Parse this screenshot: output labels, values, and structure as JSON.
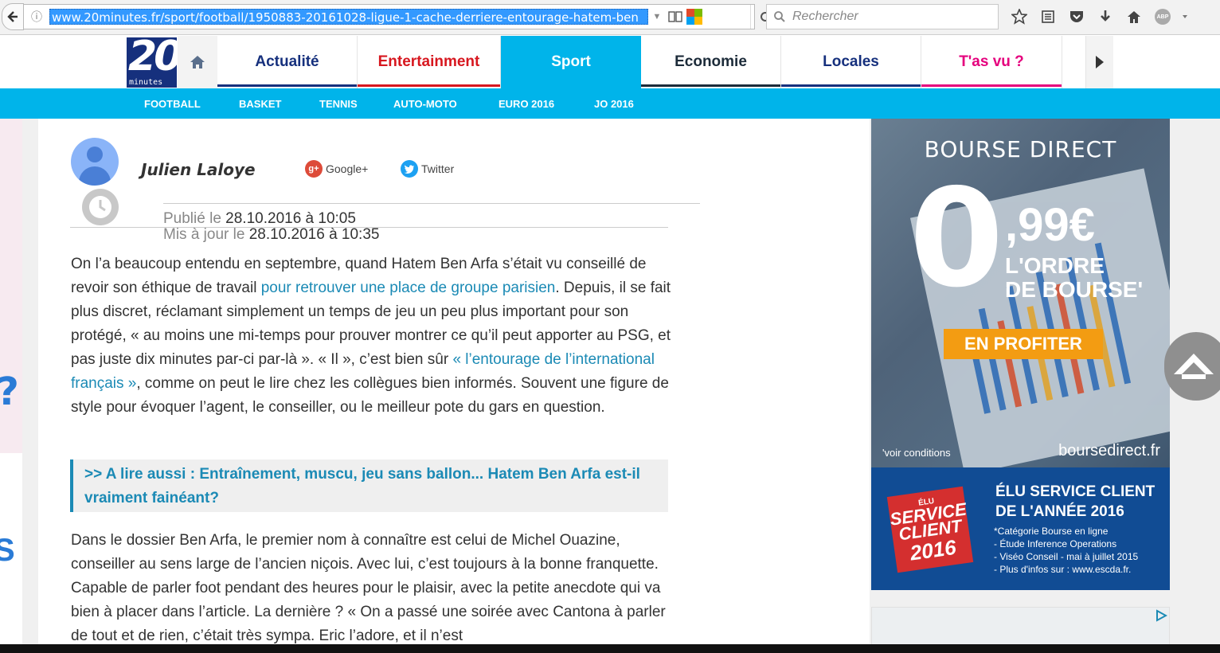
{
  "browser": {
    "url": "www.20minutes.fr/sport/football/1950883-20161028-ligue-1-cache-derriere-entourage-hatem-ben",
    "search_placeholder": "Rechercher",
    "abp_label": "ABP"
  },
  "site": {
    "logo_number": "20",
    "logo_word": "minutes",
    "tabs": [
      {
        "label": "Actualité",
        "color": "#16307d"
      },
      {
        "label": "Entertainment",
        "color": "#d7171f"
      },
      {
        "label": "Sport",
        "color": "#ffffff"
      },
      {
        "label": "Economie",
        "color": "#1c2b39"
      },
      {
        "label": "Locales",
        "color": "#16307d"
      },
      {
        "label": "T'as vu ?",
        "color": "#e5007d"
      }
    ],
    "subnav": [
      "FOOTBALL",
      "BASKET",
      "TENNIS",
      "AUTO-MOTO",
      "EURO 2016",
      "JO 2016"
    ],
    "accent": "#00b4ea"
  },
  "article": {
    "author": "Julien Laloye",
    "google_label": "Google+",
    "twitter_label": "Twitter",
    "published_label": "Publié le",
    "published_value": "28.10.2016 à 10:05",
    "updated_label": "Mis à jour le",
    "updated_value": "28.10.2016 à 10:35",
    "p1_a": "On l’a beaucoup entendu en septembre, quand Hatem Ben Arfa s’était vu conseillé de revoir son éthique de travail ",
    "p1_link": "pour retrouver une place de groupe parisien",
    "p1_b": ". Depuis, il se fait plus discret, réclamant simplement un temps de jeu un peu plus important pour son protégé, « au moins une mi-temps pour prouver montrer ce qu’il peut apporter au PSG, et pas juste dix minutes par-ci par-là ». « Il », c’est bien sûr ",
    "p1_link2": "« l’entourage de l’international français »",
    "p1_c": ", comme on peut le lire chez les collègues bien informés. Souvent une figure de style pour évoquer l’agent, le conseiller, ou le meilleur pote du gars en question.",
    "read_also": ">> A lire aussi : Entraînement, muscu, jeu sans ballon... Hatem Ben Arfa est-il vraiment fainéant?",
    "p2": "Dans le dossier Ben Arfa, le premier nom à connaître est celui de Michel Ouazine, conseiller au sens large de l’ancien niçois. Avec lui, c’est toujours à la bonne franquette. Capable de parler foot pendant des heures pour le plaisir, avec la petite anecdote qui va bien à placer dans l’article. La dernière ? « On a passé une soirée avec Cantona à parler de tout et de rien, c’était très sympa. Eric l’adore, et il n’est"
  },
  "ad": {
    "brand": "BOURSE DIRECT",
    "zero": "0",
    "cents": ",99€",
    "ordre_line1": "L'ORDRE",
    "ordre_line2": "DE BOURSE'",
    "cta": "EN PROFITER",
    "conditions": "'voir conditions",
    "site": "boursedirect.fr",
    "badge_top": "ÉLU",
    "badge_mid": "SERVICE CLIENT",
    "badge_year": "2016",
    "elu_line1": "ÉLU SERVICE CLIENT",
    "elu_line2": "DE L'ANNÉE 2016",
    "lines": [
      "*Catégorie Bourse en ligne",
      "- Étude Inference Operations",
      "- Viséo Conseil - mai à juillet 2015",
      "- Plus d'infos sur : www.escda.fr."
    ]
  },
  "left_strip_glyph": "?"
}
